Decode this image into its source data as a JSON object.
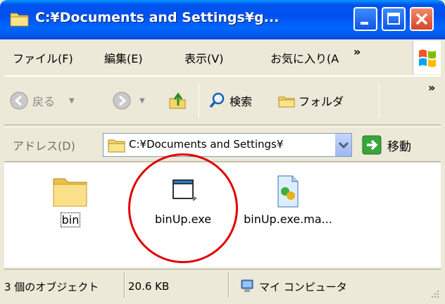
{
  "window": {
    "title": "C:¥Documents and Settings¥g..."
  },
  "menu": {
    "items": [
      "ファイル(F)",
      "編集(E)",
      "表示(V)",
      "お気に入り(A"
    ],
    "overflow": "»"
  },
  "toolbar": {
    "back_label": "戻る",
    "search_label": "検索",
    "folders_label": "フォルダ",
    "overflow": "»"
  },
  "address": {
    "label": "アドレス(D)",
    "value": "C:¥Documents and Settings¥",
    "go_label": "移動"
  },
  "files": [
    {
      "name": "bin",
      "type": "folder",
      "selected": true
    },
    {
      "name": "binUp.exe",
      "type": "exe",
      "highlighted": true
    },
    {
      "name": "binUp.exe.ma...",
      "type": "manifest"
    }
  ],
  "status": {
    "objects": "3 個のオブジェクト",
    "size": "20.6 KB",
    "location": "マイ コンピュータ"
  },
  "colors": {
    "titlebar": "#0055ea",
    "highlight_circle": "#e00000",
    "chrome": "#ece9d8"
  }
}
